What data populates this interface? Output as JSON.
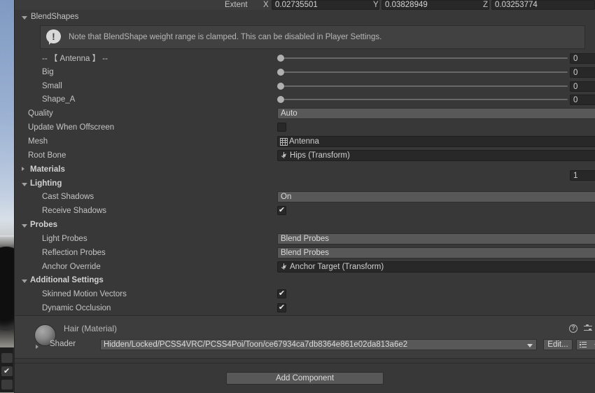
{
  "header": {
    "extent_label": "Extent",
    "axes": [
      {
        "axis": "X",
        "value": "0.02735501"
      },
      {
        "axis": "Y",
        "value": "0.03828949"
      },
      {
        "axis": "Z",
        "value": "0.03253774"
      }
    ]
  },
  "blendshapes": {
    "section_label": "BlendShapes",
    "info_text": "Note that BlendShape weight range is clamped. This can be disabled in Player Settings.",
    "info_icon": "warning-icon",
    "shapes": [
      {
        "name": "-- 【 Antenna 】 --",
        "value": "0"
      },
      {
        "name": "Big",
        "value": "0"
      },
      {
        "name": "Small",
        "value": "0"
      },
      {
        "name": "Shape_A",
        "value": "0"
      }
    ]
  },
  "renderer": {
    "quality_label": "Quality",
    "quality_value": "Auto",
    "update_offscreen_label": "Update When Offscreen",
    "update_offscreen_checked": false,
    "mesh_label": "Mesh",
    "mesh_value": "Antenna",
    "mesh_icon": "mesh-grid-icon",
    "root_bone_label": "Root Bone",
    "root_bone_value": "Hips (Transform)",
    "root_bone_icon": "transform-icon"
  },
  "materials": {
    "section_label": "Materials",
    "count": "1"
  },
  "lighting": {
    "section_label": "Lighting",
    "cast_shadows_label": "Cast Shadows",
    "cast_shadows_value": "On",
    "receive_shadows_label": "Receive Shadows",
    "receive_shadows_checked": true,
    "checkmark": "✔"
  },
  "probes": {
    "section_label": "Probes",
    "light_probes_label": "Light Probes",
    "light_probes_value": "Blend Probes",
    "reflection_probes_label": "Reflection Probes",
    "reflection_probes_value": "Blend Probes",
    "anchor_override_label": "Anchor Override",
    "anchor_override_value": "Anchor Target (Transform)",
    "anchor_override_icon": "transform-icon"
  },
  "additional_settings": {
    "section_label": "Additional Settings",
    "skinned_motion_vectors_label": "Skinned Motion Vectors",
    "skinned_motion_vectors_checked": true,
    "dynamic_occlusion_label": "Dynamic Occlusion",
    "dynamic_occlusion_checked": true
  },
  "material_inspector": {
    "title": "Hair (Material)",
    "shader_label": "Shader",
    "shader_value": "Hidden/Locked/PCSS4VRC/PCSS4Poi/Toon/ce67934ca7db8364e861e02da813a6e2",
    "edit_button": "Edit...",
    "help_icon": "help-icon",
    "preset_icon": "preset-icon",
    "menu_icon": "kebab-menu-icon",
    "list_icon": "shader-list-icon"
  },
  "footer": {
    "add_component_label": "Add Component"
  },
  "colors": {
    "panel_bg": "#383838",
    "field_bg": "#282828",
    "dropdown_bg": "#585858",
    "text": "#c4c4c4",
    "helpbox_bg": "#414141"
  }
}
